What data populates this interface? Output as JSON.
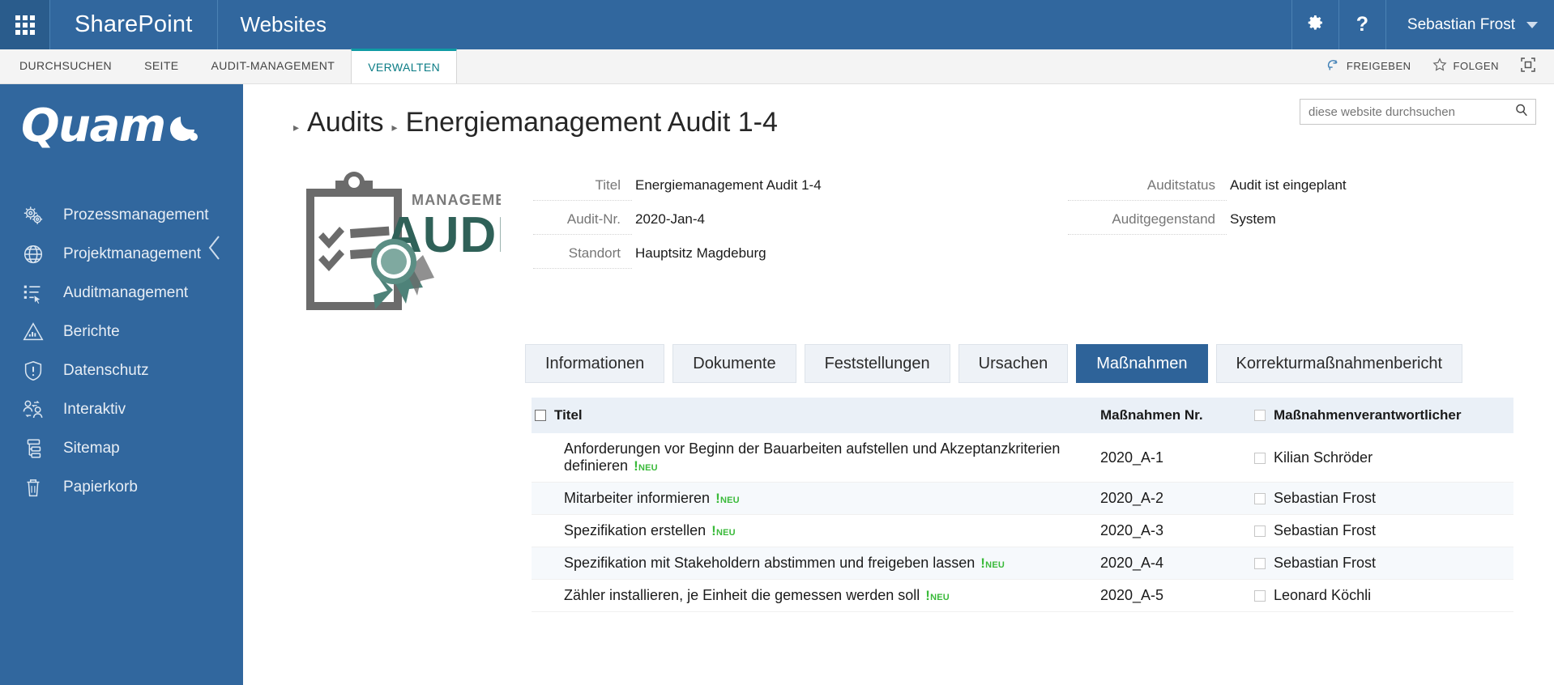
{
  "suite": {
    "waffle_icon": "waffle-grid-icon",
    "brand": "SharePoint",
    "site_name": "Websites",
    "settings_icon": "gear-icon",
    "help_icon": "question-icon",
    "user_name": "Sebastian Frost"
  },
  "ribbon": {
    "tabs": [
      {
        "label": "DURCHSUCHEN",
        "active": false
      },
      {
        "label": "SEITE",
        "active": false
      },
      {
        "label": "AUDIT-MANAGEMENT",
        "active": false
      },
      {
        "label": "VERWALTEN",
        "active": true
      }
    ],
    "actions": [
      {
        "label": "FREIGEBEN",
        "icon": "share-icon"
      },
      {
        "label": "FOLGEN",
        "icon": "star-icon"
      }
    ],
    "focus_icon": "focus-on-content-icon"
  },
  "sidebar": {
    "logo_text": "Quam",
    "collapse_icon": "chevron-left-icon",
    "items": [
      {
        "label": "Prozessmanagement",
        "icon": "gears-icon"
      },
      {
        "label": "Projektmanagement",
        "icon": "globe-icon"
      },
      {
        "label": "Auditmanagement",
        "icon": "list-cursor-icon"
      },
      {
        "label": "Berichte",
        "icon": "chart-triangle-icon"
      },
      {
        "label": "Datenschutz",
        "icon": "shield-alert-icon"
      },
      {
        "label": "Interaktiv",
        "icon": "people-exchange-icon"
      },
      {
        "label": "Sitemap",
        "icon": "sitemap-icon"
      },
      {
        "label": "Papierkorb",
        "icon": "trash-icon"
      }
    ]
  },
  "search": {
    "placeholder": "diese website durchsuchen",
    "value": "",
    "icon": "search-icon"
  },
  "breadcrumb": {
    "parent": "Audits",
    "current": "Energiemanagement Audit 1-4"
  },
  "logo": {
    "small_text": "MANAGEMENT",
    "big_text": "AUDIT"
  },
  "details": {
    "left": [
      {
        "label": "Titel",
        "value": "Energiemanagement Audit 1-4"
      },
      {
        "label": "Audit-Nr.",
        "value": "2020-Jan-4"
      },
      {
        "label": "Standort",
        "value": "Hauptsitz Magdeburg"
      }
    ],
    "right": [
      {
        "label": "Auditstatus",
        "value": "Audit ist eingeplant"
      },
      {
        "label": "Auditgegenstand",
        "value": "System"
      }
    ]
  },
  "tabs": [
    {
      "label": "Informationen",
      "active": false
    },
    {
      "label": "Dokumente",
      "active": false
    },
    {
      "label": "Feststellungen",
      "active": false
    },
    {
      "label": "Ursachen",
      "active": false
    },
    {
      "label": "Maßnahmen",
      "active": true
    },
    {
      "label": "Korrekturmaßnahmenbericht",
      "active": false
    }
  ],
  "table": {
    "columns": {
      "title": "Titel",
      "number": "Maßnahmen Nr.",
      "responsible": "Maßnahmenverantwortlicher"
    },
    "badge": {
      "bang": "!",
      "text": "NEU",
      "color": "#3aba3a"
    },
    "rows": [
      {
        "title": "Anforderungen vor Beginn der Bauarbeiten aufstellen und Akzeptanzkriterien definieren",
        "badge": "NEU",
        "number": "2020_A-1",
        "responsible": "Kilian Schröder"
      },
      {
        "title": "Mitarbeiter informieren",
        "badge": "NEU",
        "number": "2020_A-2",
        "responsible": "Sebastian Frost"
      },
      {
        "title": "Spezifikation erstellen",
        "badge": "NEU",
        "number": "2020_A-3",
        "responsible": "Sebastian Frost"
      },
      {
        "title": "Spezifikation mit Stakeholdern abstimmen und freigeben lassen",
        "badge": "NEU",
        "number": "2020_A-4",
        "responsible": "Sebastian Frost"
      },
      {
        "title": "Zähler installieren, je Einheit die gemessen werden soll",
        "badge": "NEU",
        "number": "2020_A-5",
        "responsible": "Leonard Köchli"
      }
    ]
  },
  "colors": {
    "suite_bar": "#31679e",
    "sidebar": "#31679e",
    "active_tab": "#2e6399",
    "ribbon_accent": "#0f9ba4",
    "badge_green": "#3aba3a",
    "row_alt": "#f6f9fc",
    "table_header": "#eaf0f7"
  }
}
